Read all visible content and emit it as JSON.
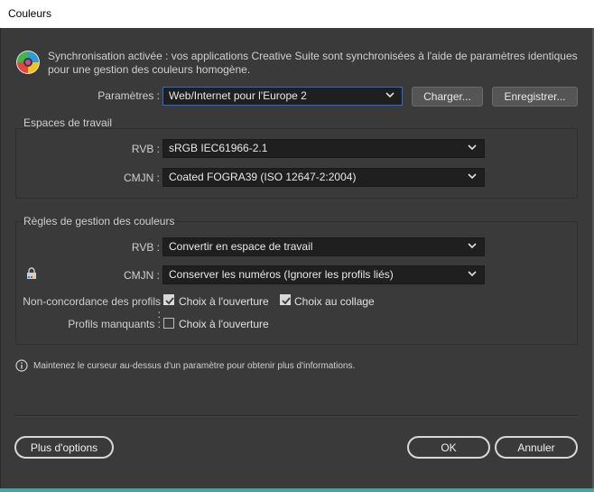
{
  "window": {
    "title": "Couleurs"
  },
  "sync": {
    "icon": "color-wheel-icon",
    "message": "Synchronisation activée : vos applications Creative Suite sont synchronisées à l'aide de paramètres identiques pour une gestion des couleurs homogène."
  },
  "settings": {
    "label": "Paramètres :",
    "value": "Web/Internet pour l'Europe 2",
    "load_label": "Charger...",
    "save_label": "Enregistrer..."
  },
  "working_spaces": {
    "title": "Espaces de travail",
    "rgb_label": "RVB :",
    "rgb_value": "sRGB IEC61966-2.1",
    "cmyk_label": "CMJN :",
    "cmyk_value": "Coated FOGRA39 (ISO 12647-2:2004)"
  },
  "policies": {
    "title": "Règles de gestion des couleurs",
    "rgb_label": "RVB :",
    "rgb_value": "Convertir en espace de travail",
    "cmyk_label": "CMJN :",
    "cmyk_value": "Conserver les numéros (Ignorer les profils liés)",
    "mismatch_label": "Non-concordance des profils :",
    "mismatch_open": {
      "label": "Choix à l'ouverture",
      "checked": true
    },
    "mismatch_paste": {
      "label": "Choix au collage",
      "checked": true
    },
    "missing_label": "Profils manquants :",
    "missing_open": {
      "label": "Choix à l'ouverture",
      "checked": false
    }
  },
  "info": {
    "icon": "info-icon",
    "text": "Maintenez le curseur au-dessus d'un paramètre pour obtenir plus d'informations."
  },
  "footer": {
    "more_options_label": "Plus d'options",
    "ok_label": "OK",
    "cancel_label": "Annuler"
  },
  "colors": {
    "dialog_bg": "#3a3a3a",
    "dropdown_bg": "#1f1f1f",
    "focus_border": "#2d6bd8",
    "titlebar_bg": "#ffffff"
  }
}
